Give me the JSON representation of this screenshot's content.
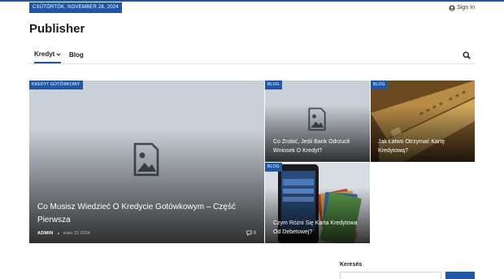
{
  "topbar": {
    "date": "CSÜTÖRTÖK, NOVEMBER 28, 2024",
    "signin_label": "Sign In",
    "accent_color": "#1e56a8"
  },
  "site": {
    "title": "Publisher"
  },
  "nav": {
    "items": [
      {
        "label": "Kredyt"
      },
      {
        "label": "Blog"
      }
    ]
  },
  "featured": {
    "main": {
      "category": "KREDYT GOTÓWKOWY",
      "title": "Co Musisz Wiedzieć O Kredycie Gotówkowym – Część Pierwsza",
      "author": "ADMIN",
      "date": "maio 22 2024",
      "comments": "0"
    },
    "cards": [
      {
        "category": "BLOG",
        "title": "Co Zrobić, Jeśli Bank Odrzucił Wniosek O Kredyt?"
      },
      {
        "category": "BLOG",
        "title": "Jak Łatwo Otrzymać Kartę Kredytową?"
      },
      {
        "category": "BLOG",
        "title": "Czym Różni Się Karta Kredytowa Od Debetowej?"
      }
    ]
  },
  "sidebar": {
    "search_label": "Keresés"
  }
}
